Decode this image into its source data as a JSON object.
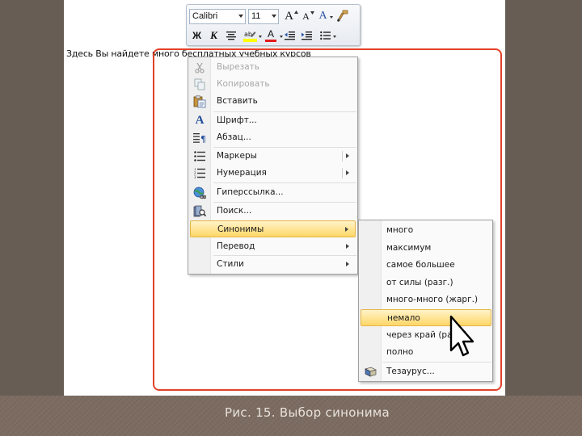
{
  "document": {
    "text": "Здесь Вы найдете много бесплатных учебных курсов"
  },
  "mini_toolbar": {
    "font_name": "Calibri",
    "font_size": "11",
    "bold": "Ж",
    "italic": "К",
    "font_color_glyph": "A",
    "grow_font_glyph": "A",
    "shrink_font_glyph": "A",
    "styles_glyph": "A"
  },
  "context_menu": {
    "items": [
      {
        "label": "Вырезать",
        "icon": "scissors-icon",
        "disabled": true
      },
      {
        "label": "Копировать",
        "icon": "copy-icon",
        "disabled": true
      },
      {
        "label": "Вставить",
        "icon": "paste-icon",
        "disabled": false
      },
      {
        "label": "Шрифт...",
        "icon": "font-icon",
        "disabled": false
      },
      {
        "label": "Абзац...",
        "icon": "paragraph-icon",
        "disabled": false
      },
      {
        "label": "Маркеры",
        "icon": "bullets-icon",
        "disabled": false,
        "submenu": true
      },
      {
        "label": "Нумерация",
        "icon": "numbering-icon",
        "disabled": false,
        "submenu": true
      },
      {
        "label": "Гиперссылка...",
        "icon": "hyperlink-icon",
        "disabled": false
      },
      {
        "label": "Поиск...",
        "icon": "research-icon",
        "disabled": false
      },
      {
        "label": "Синонимы",
        "icon": "",
        "disabled": false,
        "submenu": true,
        "active": true
      },
      {
        "label": "Перевод",
        "icon": "",
        "disabled": false,
        "submenu": true
      },
      {
        "label": "Стили",
        "icon": "",
        "disabled": false,
        "submenu": true
      }
    ]
  },
  "synonyms_menu": {
    "items": [
      {
        "label": "много"
      },
      {
        "label": "максимум"
      },
      {
        "label": "самое большее"
      },
      {
        "label": "от силы (разг.)"
      },
      {
        "label": "много-много (жарг.)"
      },
      {
        "label": "немало",
        "active": true
      },
      {
        "label": "через край (разг.)"
      },
      {
        "label": "полно"
      }
    ],
    "thesaurus_label": "Тезаурус..."
  },
  "caption": "Рис. 15. Выбор синонима",
  "colors": {
    "highlight_frame": "#e2412a",
    "menu_hover": "#ffd767",
    "background": "#7b6b60"
  }
}
